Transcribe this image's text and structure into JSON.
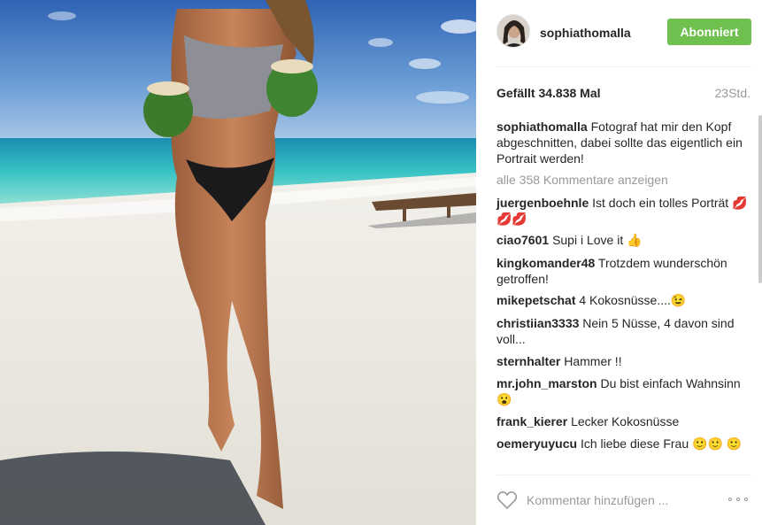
{
  "post": {
    "username": "sophiathomalla",
    "follow_label": "Abonniert",
    "likes": "Gefällt 34.838 Mal",
    "time": "23Std.",
    "caption": "Fotograf hat mir den Kopf abgeschnitten, dabei sollte das eigentlich ein Portrait werden!",
    "view_all": "alle 358 Kommentare anzeigen"
  },
  "comments": [
    {
      "user": "juergenboehnle",
      "text": "Ist doch ein tolles Porträt 💋💋💋"
    },
    {
      "user": "ciao7601",
      "text": "Supi i Love it 👍"
    },
    {
      "user": "kingkomander48",
      "text": "Trotzdem wunderschön getroffen!"
    },
    {
      "user": "mikepetschat",
      "text": "4 Kokosnüsse....😉"
    },
    {
      "user": "christiian3333",
      "text": "Nein 5 Nüsse, 4 davon sind voll..."
    },
    {
      "user": "sternhalter",
      "text": "Hammer !!"
    },
    {
      "user": "mr.john_marston",
      "text": "Du bist einfach Wahnsinn 😮"
    },
    {
      "user": "frank_kierer",
      "text": "Lecker Kokosnüsse"
    },
    {
      "user": "oemeryuyucu",
      "text": "Ich liebe diese Frau 🙂🙂 🙂"
    }
  ],
  "footer": {
    "comment_placeholder": "Kommentar hinzufügen ...",
    "heart_icon": "heart-icon",
    "more_icon": "more-options-icon"
  },
  "colors": {
    "follow_button": "#70c050",
    "username": "#262626",
    "muted": "#999999"
  }
}
